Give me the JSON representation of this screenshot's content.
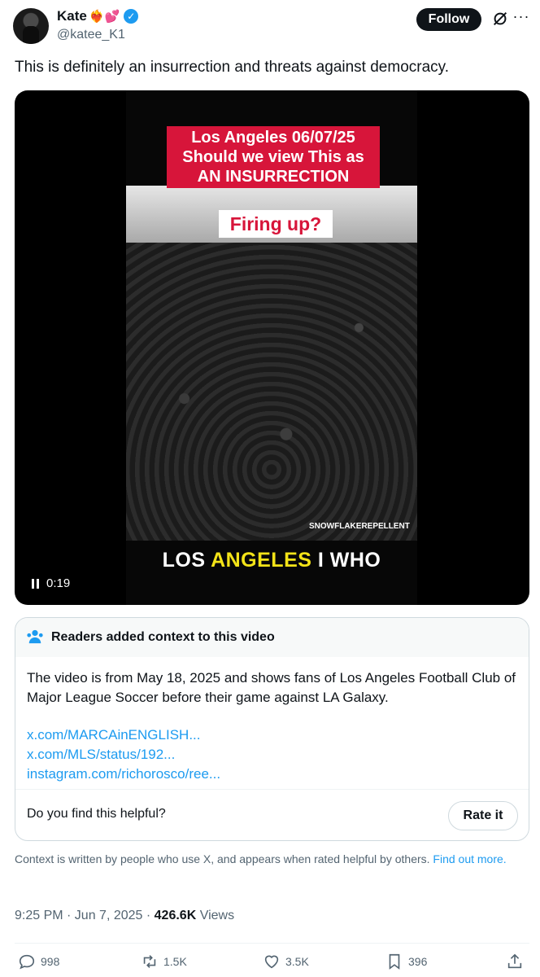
{
  "author": {
    "display_name": "Kate",
    "name_emojis": "❤️‍🔥💕",
    "handle": "@katee_K1"
  },
  "header": {
    "follow_label": "Follow",
    "more_label": "···"
  },
  "tweet": {
    "text": "This is definitely an insurrection and threats against democracy."
  },
  "video": {
    "banner_text": "Los Angeles 06/07/25 Should we view This as AN INSURRECTION",
    "overlay_label": "Firing up?",
    "watermark": "SNOWFLAKEREPELLENT",
    "bottom_title_part1": "LOS",
    "bottom_title_part2": "ANGELES",
    "bottom_title_part3": "I WHO",
    "time": "0:19"
  },
  "note": {
    "title": "Readers added context to this video",
    "body": "The video is from May 18, 2025 and shows fans of Los Angeles Football Club of Major League Soccer before their game against LA Galaxy.",
    "links": [
      "x.com/MARCAinENGLISH...",
      "x.com/MLS/status/192...",
      "instagram.com/richorosco/ree..."
    ],
    "helpful_question": "Do you find this helpful?",
    "rate_label": "Rate it"
  },
  "context": {
    "text": "Context is written by people who use X, and appears when rated helpful by others.",
    "link": "Find out more."
  },
  "meta": {
    "time": "9:25 PM · Jun 7, 2025 · ",
    "views_count": "426.6K",
    "views_label": " Views"
  },
  "actions": {
    "replies": "998",
    "reposts": "1.5K",
    "likes": "3.5K",
    "bookmarks": "396"
  },
  "colors": {
    "accent": "#1d9bf0",
    "text": "#0f1419",
    "muted": "#536471",
    "banner_red": "#d7153a",
    "title_yellow": "#f3e318"
  }
}
